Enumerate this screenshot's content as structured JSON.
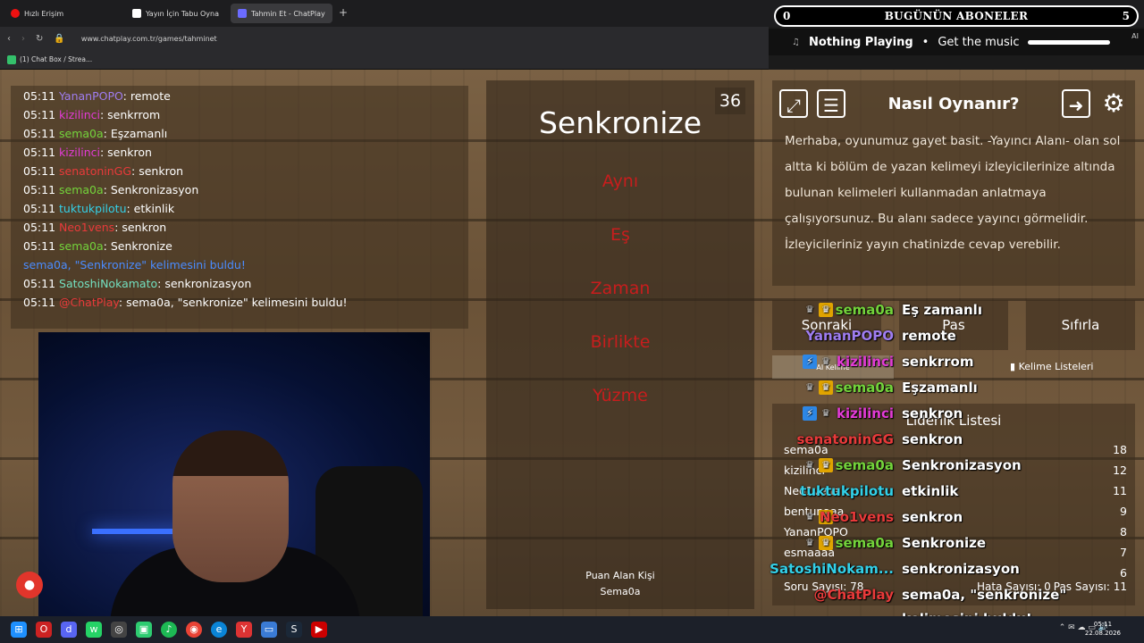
{
  "browser": {
    "tabs": [
      {
        "label": "Hızlı Erişim"
      },
      {
        "label": "Yayın İçin Tabu Oyna"
      },
      {
        "label": "Tahmin Et - ChatPlay"
      }
    ],
    "url": "www.chatplay.com.tr/games/tahminet",
    "bookmark": "(1) Chat Box / Strea..."
  },
  "overlay_top": {
    "subs_count": "0",
    "subs_title": "BUGÜNÜN ABONELER",
    "subs_count_right": "5",
    "now_playing": "Nothing Playing",
    "get_music": "Get the music",
    "ai": "AI"
  },
  "chat_log": [
    {
      "time": "05:11",
      "user": "YananPOPO",
      "color": "#9f7df0",
      "msg": ": remote"
    },
    {
      "time": "05:11",
      "user": "kizilinci",
      "color": "#e33bd6",
      "msg": ": senkrrom"
    },
    {
      "time": "05:11",
      "user": "sema0a",
      "color": "#73d33b",
      "msg": ": Eşzamanlı"
    },
    {
      "time": "05:11",
      "user": "kizilinci",
      "color": "#e33bd6",
      "msg": ": senkron"
    },
    {
      "time": "05:11",
      "user": "senatoninGG",
      "color": "#e83a3a",
      "msg": ": senkron"
    },
    {
      "time": "05:11",
      "user": "sema0a",
      "color": "#73d33b",
      "msg": ": Senkronizasyon"
    },
    {
      "time": "05:11",
      "user": "tuktukpilotu",
      "color": "#33d0e8",
      "msg": ": etkinlik"
    },
    {
      "time": "05:11",
      "user": "Neo1vens",
      "color": "#e83a3a",
      "msg": ": senkron"
    },
    {
      "time": "05:11",
      "user": "sema0a",
      "color": "#73d33b",
      "msg": ": Senkronize"
    },
    {
      "time": "",
      "user": "sema0a, \"Senkronize\" kelimesini buldu!",
      "color": "#4a8cff",
      "msg": ""
    },
    {
      "time": "05:11",
      "user": "SatoshiNokamato",
      "color": "#73e0c0",
      "msg": ": senkronizasyon"
    },
    {
      "time": "05:11",
      "user": "@ChatPlay",
      "color": "#e83a3a",
      "msg": ": sema0a, \"senkronize\" kelimesini buldu!"
    }
  ],
  "game": {
    "word": "Senkronize",
    "timer": "36",
    "forbidden": [
      "Aynı",
      "Eş",
      "Zaman",
      "Birlikte",
      "Yüzme"
    ],
    "scorer_label": "Puan Alan Kişi",
    "scorer_name": "Sema0a"
  },
  "howto": {
    "title": "Nasıl Oynanır?",
    "desc": "Merhaba, oyunumuz gayet basit. -Yayıncı Alanı- olan sol altta ki bölüm de yazan kelimeyi izleyicilerinize altında bulunan kelimeleri kullanmadan anlatmaya çalışıyorsunuz. Bu alanı sadece yayıncı görmelidir. İzleyicileriniz yayın chatinizde cevap verebilir."
  },
  "controls": {
    "next": "Sonraki",
    "pass": "Pas",
    "reset": "Sıfırla",
    "word_lists": "Kelime Listeleri",
    "ai_word": "AI Kelime"
  },
  "leaderboard": {
    "title": "Liderlik Listesi",
    "rows": [
      {
        "name": "sema0a",
        "score": "18"
      },
      {
        "name": "kizilinci",
        "score": "12"
      },
      {
        "name": "Neo1vens",
        "score": "11"
      },
      {
        "name": "bentunaaa",
        "score": "9"
      },
      {
        "name": "YananPOPO",
        "score": "8"
      },
      {
        "name": "esmaaaa",
        "score": "7"
      },
      {
        "name": "",
        "score": "6"
      }
    ],
    "question_count": "Soru Sayısı: 78",
    "error_count": "Hata Sayısı: 0",
    "pass_count": "Pas Sayısı: 11"
  },
  "overlay_chat": [
    {
      "user": "sema0a",
      "color": "#73d33b",
      "msg": "Eş zamanlı",
      "badges": [
        "crown",
        "gold"
      ]
    },
    {
      "user": "YananPOPO",
      "color": "#9f7df0",
      "msg": "remote",
      "badges": []
    },
    {
      "user": "kizilinci",
      "color": "#e33bd6",
      "msg": "senkrrom",
      "badges": [
        "blue",
        "crown"
      ]
    },
    {
      "user": "sema0a",
      "color": "#73d33b",
      "msg": "Eşzamanlı",
      "badges": [
        "crown",
        "gold"
      ]
    },
    {
      "user": "kizilinci",
      "color": "#e33bd6",
      "msg": "senkron",
      "badges": [
        "blue",
        "crown"
      ]
    },
    {
      "user": "senatoninGG",
      "color": "#e83a3a",
      "msg": "senkron",
      "badges": []
    },
    {
      "user": "sema0a",
      "color": "#73d33b",
      "msg": "Senkronizasyon",
      "badges": [
        "crown",
        "gold"
      ]
    },
    {
      "user": "tuktukpilotu",
      "color": "#33d0e8",
      "msg": "etkinlik",
      "badges": []
    },
    {
      "user": "Neo1vens",
      "color": "#e83a3a",
      "msg": "senkron",
      "badges": [
        "crown",
        "gold"
      ]
    },
    {
      "user": "sema0a",
      "color": "#73d33b",
      "msg": "Senkronize",
      "badges": [
        "crown",
        "gold"
      ]
    },
    {
      "user": "SatoshiNokam...",
      "color": "#33d0e8",
      "msg": "senkronizasyon",
      "badges": []
    },
    {
      "user": "@ChatPlay",
      "color": "#e83a3a",
      "msg": "sema0a, \"senkronize\"",
      "badges": []
    }
  ],
  "overlay_chat_tail": "kelimesini buldu!",
  "taskbar": {
    "time": "05:11",
    "date": "22.08.2026"
  }
}
